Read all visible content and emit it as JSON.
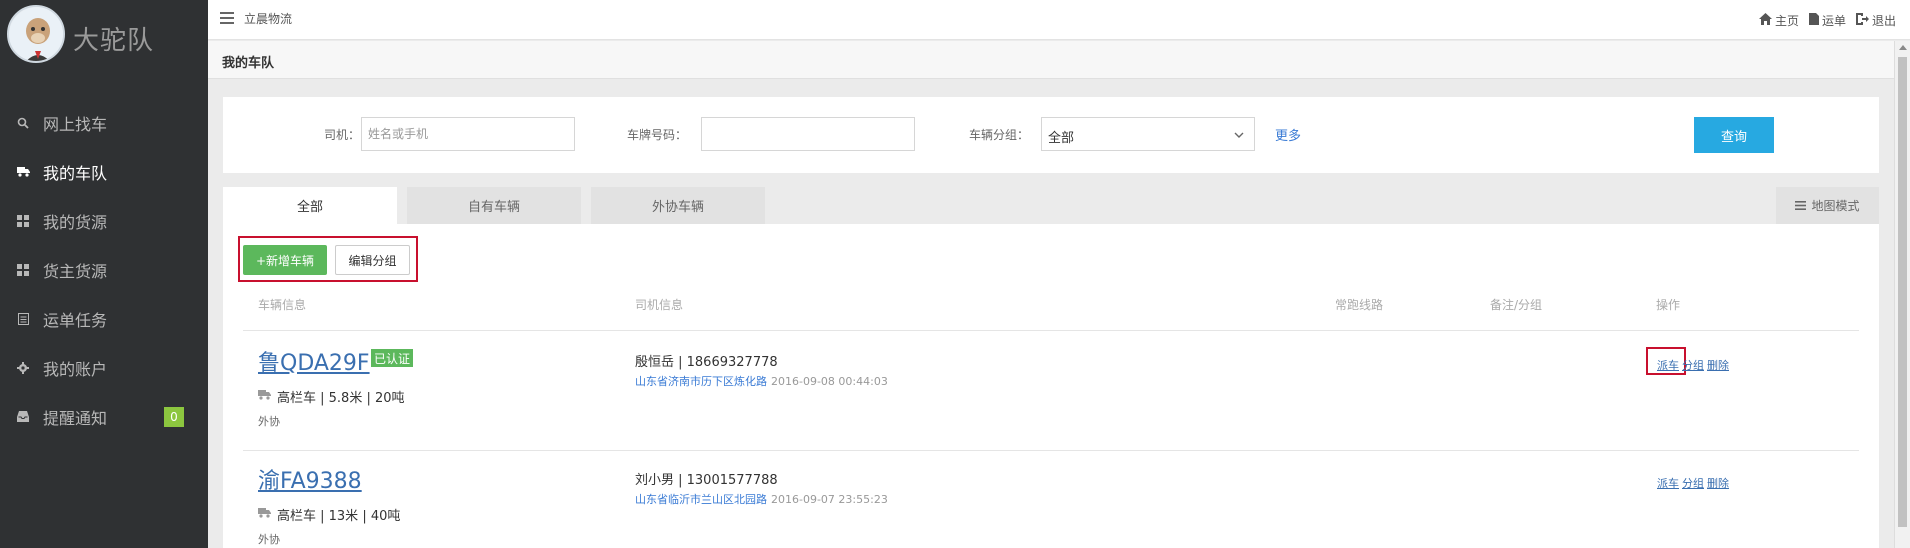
{
  "brand": {
    "name": "大驼队"
  },
  "sidebar": {
    "items": [
      {
        "label": "网上找车",
        "icon": "search-icon"
      },
      {
        "label": "我的车队",
        "icon": "truck-icon",
        "active": true
      },
      {
        "label": "我的货源",
        "icon": "boxes-icon"
      },
      {
        "label": "货主货源",
        "icon": "boxes-icon"
      },
      {
        "label": "运单任务",
        "icon": "list-icon"
      },
      {
        "label": "我的账户",
        "icon": "gear-icon"
      },
      {
        "label": "提醒通知",
        "icon": "inbox-icon",
        "badge": "0"
      }
    ]
  },
  "topbar": {
    "company": "立晨物流",
    "links": {
      "home": "主页",
      "waybill": "运单",
      "logout": "退出"
    }
  },
  "breadcrumb": {
    "title": "我的车队"
  },
  "filter": {
    "driver_label": "司机：",
    "driver_placeholder": "姓名或手机",
    "plate_label": "车牌号码：",
    "group_label": "车辆分组：",
    "group_value": "全部",
    "more": "更多",
    "query": "查询"
  },
  "tabs": {
    "all": "全部",
    "own": "自有车辆",
    "external": "外协车辆",
    "map_mode": "地图模式"
  },
  "actions": {
    "add_vehicle": "+新增车辆",
    "edit_group": "编辑分组"
  },
  "table": {
    "headers": {
      "vehicle": "车辆信息",
      "driver": "司机信息",
      "route": "常跑线路",
      "remark": "备注/分组",
      "ops": "操作"
    },
    "rows": [
      {
        "plate": "鲁QDA29F",
        "certified": "已认证",
        "truck": "高栏车 | 5.8米 | 20吨",
        "tag": "外协",
        "driver": "殷恒岳 | 18669327778",
        "location": "山东省济南市历下区炼化路",
        "time": "2016-09-08 00:44:03",
        "ops": {
          "dispatch": "派车",
          "group": "分组",
          "delete": "删除"
        }
      },
      {
        "plate": "渝FA9388",
        "truck": "高栏车 | 13米 | 40吨",
        "tag": "外协",
        "driver": "刘小男 | 13001577788",
        "location": "山东省临沂市兰山区北园路",
        "time": "2016-09-07 23:55:23",
        "ops": {
          "dispatch": "派车",
          "group": "分组",
          "delete": "删除"
        }
      }
    ]
  }
}
